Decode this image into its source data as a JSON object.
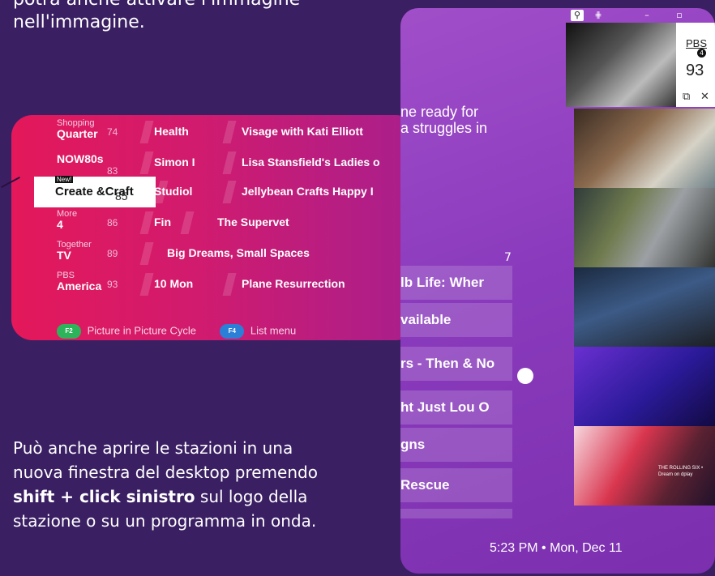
{
  "caption_top": "potrà anche attivare l'immagine nell'immagine.",
  "caption_bottom": {
    "part1": "Può anche aprire le stazioni in una nuova finestra del desktop premendo ",
    "bold1": "shift + click sinistro",
    "part2": " sul logo della stazione o su un programma in onda."
  },
  "guide": {
    "rows": [
      {
        "top": "Shopping",
        "main": "Quarter",
        "num": "74",
        "programs": [
          "Health",
          "Visage with Kati Elliott"
        ]
      },
      {
        "top": "",
        "main": "NOW80s",
        "num": "83",
        "programs": [
          "Simon I",
          "Lisa Stansfield's Ladies o"
        ]
      },
      {
        "top": "New!",
        "main": "Create &Craft",
        "num": "85",
        "programs": [
          "Studiol",
          "Jellybean Crafts Happy I"
        ]
      },
      {
        "top": "More",
        "main": "4",
        "num": "86",
        "programs": [
          "Fin",
          "The Supervet"
        ]
      },
      {
        "top": "Together",
        "main": "TV",
        "num": "89",
        "programs": [
          "Big Dreams, Small Spaces"
        ]
      },
      {
        "top": "PBS",
        "main": "America",
        "num": "93",
        "programs": [
          "10 Mon",
          "Plane Resurrection"
        ]
      }
    ],
    "legend": {
      "f2_key": "F2",
      "f2_label": "Picture in Picture Cycle",
      "f4_key": "F4",
      "f4_label": "List menu"
    }
  },
  "app": {
    "description_line1": "ne ready for",
    "description_line2": "a struggles in",
    "seven": "7",
    "programs": [
      "lb Life: Wher",
      "vailable",
      "rs - Then & No",
      "ht Just Lou O",
      "gns",
      "Rescue"
    ],
    "time": "5:23 PM • Mon, Dec 11",
    "mini_player": {
      "logo": "PBS",
      "logo_num": "4",
      "channel": "93",
      "popout_icon": "popout-icon",
      "close_icon": "close-icon"
    },
    "thumb5_text": "THE ROLLING SIX • Dream on dplay"
  },
  "colors": {
    "background": "#3a1f63",
    "guide_pink": "#e4185a",
    "app_purple": "#8a3bbd",
    "key_green": "#2db35a",
    "key_blue": "#2b7fd6"
  }
}
